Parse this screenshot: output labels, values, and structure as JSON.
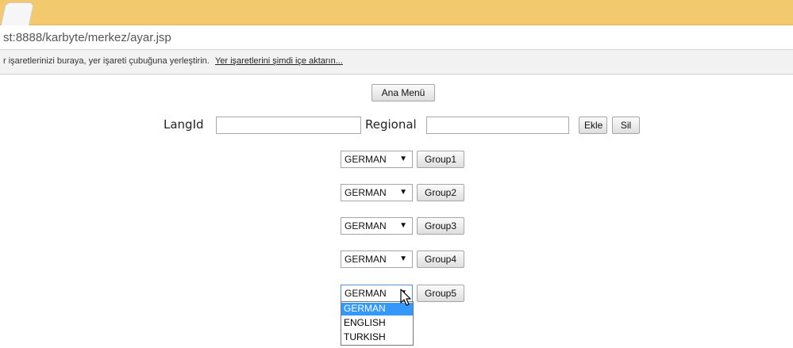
{
  "browser": {
    "url": "st:8888/karbyte/merkez/ayar.jsp",
    "bookmarks_text": "r işaretlerinizi buraya, yer işareti çubuğuna yerleştirin.",
    "bookmarks_link": "Yer işaretlerini şimdi içe aktarın..."
  },
  "page": {
    "main_menu_label": "Ana Menü",
    "langid_label": "LangId",
    "langid_value": "",
    "regional_label": "Regional",
    "regional_value": "",
    "add_label": "Ekle",
    "delete_label": "Sil",
    "groups": [
      {
        "selected": "GERMAN",
        "button": "Group1"
      },
      {
        "selected": "GERMAN",
        "button": "Group2"
      },
      {
        "selected": "GERMAN",
        "button": "Group3"
      },
      {
        "selected": "GERMAN",
        "button": "Group4"
      },
      {
        "selected": "GERMAN",
        "button": "Group5"
      }
    ],
    "open_dropdown": {
      "options": [
        "GERMAN",
        "ENGLISH",
        "TURKISH"
      ],
      "highlighted": "GERMAN"
    }
  },
  "icons": {
    "dropdown_arrow": "▼"
  }
}
